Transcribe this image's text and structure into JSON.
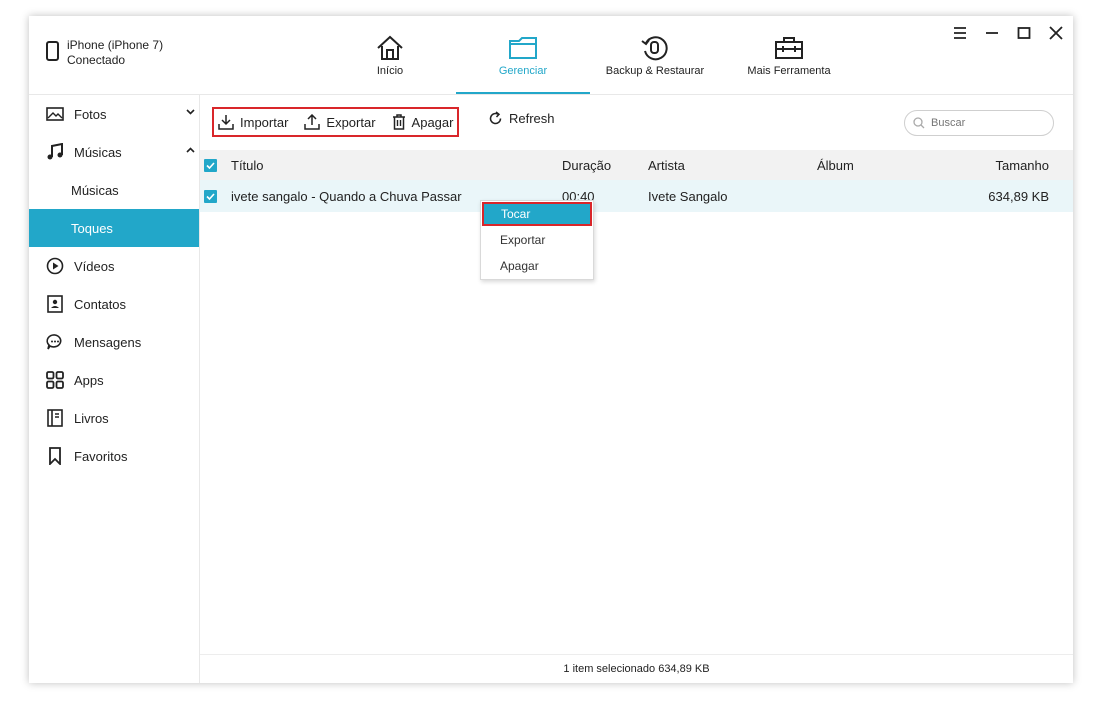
{
  "device": {
    "name": "iPhone (iPhone 7)",
    "status": "Conectado"
  },
  "nav": {
    "home": "Início",
    "manage": "Gerenciar",
    "backup": "Backup & Restaurar",
    "tools": "Mais Ferramenta"
  },
  "sidebar": {
    "fotos": "Fotos",
    "musicas": "Músicas",
    "sub_musicas": "Músicas",
    "sub_toques": "Toques",
    "videos": "Vídeos",
    "contatos": "Contatos",
    "mensagens": "Mensagens",
    "apps": "Apps",
    "livros": "Livros",
    "favoritos": "Favoritos"
  },
  "toolbar": {
    "importar": "Importar",
    "exportar": "Exportar",
    "apagar": "Apagar",
    "refresh": "Refresh",
    "search_placeholder": "Buscar"
  },
  "table": {
    "headers": {
      "title": "Título",
      "duration": "Duração",
      "artist": "Artista",
      "album": "Álbum",
      "size": "Tamanho"
    },
    "rows": [
      {
        "title": "ivete sangalo - Quando a Chuva Passar",
        "duration": "00:40",
        "artist": "Ivete Sangalo",
        "album": "",
        "size": "634,89 KB"
      }
    ]
  },
  "context_menu": {
    "play": "Tocar",
    "export": "Exportar",
    "delete": "Apagar"
  },
  "footer": {
    "status": "1 item selecionado 634,89 KB"
  },
  "colors": {
    "accent": "#22a7c9",
    "highlight_border": "#d9262a"
  }
}
